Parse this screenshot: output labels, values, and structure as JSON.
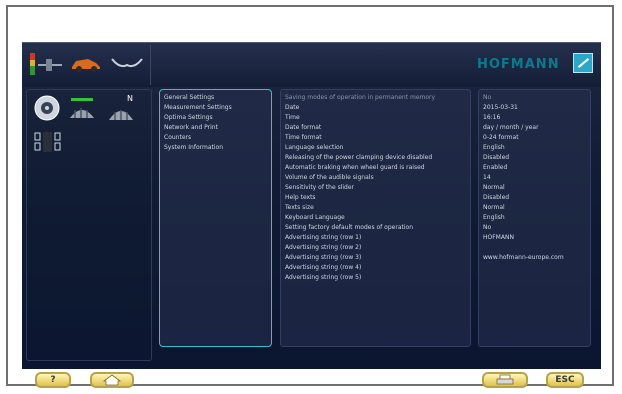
{
  "header": {
    "logo": "HOFMANN"
  },
  "menu": {
    "items": [
      {
        "label": "General Settings"
      },
      {
        "label": "Measurement Settings"
      },
      {
        "label": "Optima Settings"
      },
      {
        "label": "Network and Print"
      },
      {
        "label": "Counters"
      },
      {
        "label": "System Information"
      }
    ]
  },
  "settings": {
    "rows": [
      {
        "param": "Saving modes of operation in permanent memory",
        "value": "No"
      },
      {
        "param": "Date",
        "value": "2015-03-31"
      },
      {
        "param": "Time",
        "value": "16:16"
      },
      {
        "param": "Date format",
        "value": "day / month / year"
      },
      {
        "param": "Time format",
        "value": "0-24 format"
      },
      {
        "param": "Language selection",
        "value": "English"
      },
      {
        "param": "Releasing of the power clamping device disabled",
        "value": "Disabled"
      },
      {
        "param": "Automatic braking when wheel guard is raised",
        "value": "Enabled"
      },
      {
        "param": "Volume of the audible signals",
        "value": "14"
      },
      {
        "param": "Sensitivity of the slider",
        "value": "Normal"
      },
      {
        "param": "Help texts",
        "value": "Disabled"
      },
      {
        "param": "Texts size",
        "value": "Normal"
      },
      {
        "param": "Keyboard Language",
        "value": "English"
      },
      {
        "param": "Setting factory default modes of operation",
        "value": "No"
      },
      {
        "param": "Advertising string (row 1)",
        "value": "HOFMANN"
      },
      {
        "param": "Advertising string (row 2)",
        "value": ""
      },
      {
        "param": "Advertising string (row 3)",
        "value": "www.hofmann-europe.com"
      },
      {
        "param": "Advertising string (row 4)",
        "value": ""
      },
      {
        "param": "Advertising string (row 5)",
        "value": ""
      }
    ]
  },
  "toolbar": {
    "help_label": "?",
    "home_icon": "home-icon",
    "print_icon": "printer-icon",
    "esc_label": "ESC"
  },
  "colors": {
    "screen_bg": "#101c33",
    "accent": "#2ec3d0",
    "button_yellow": "#e0c14b"
  }
}
